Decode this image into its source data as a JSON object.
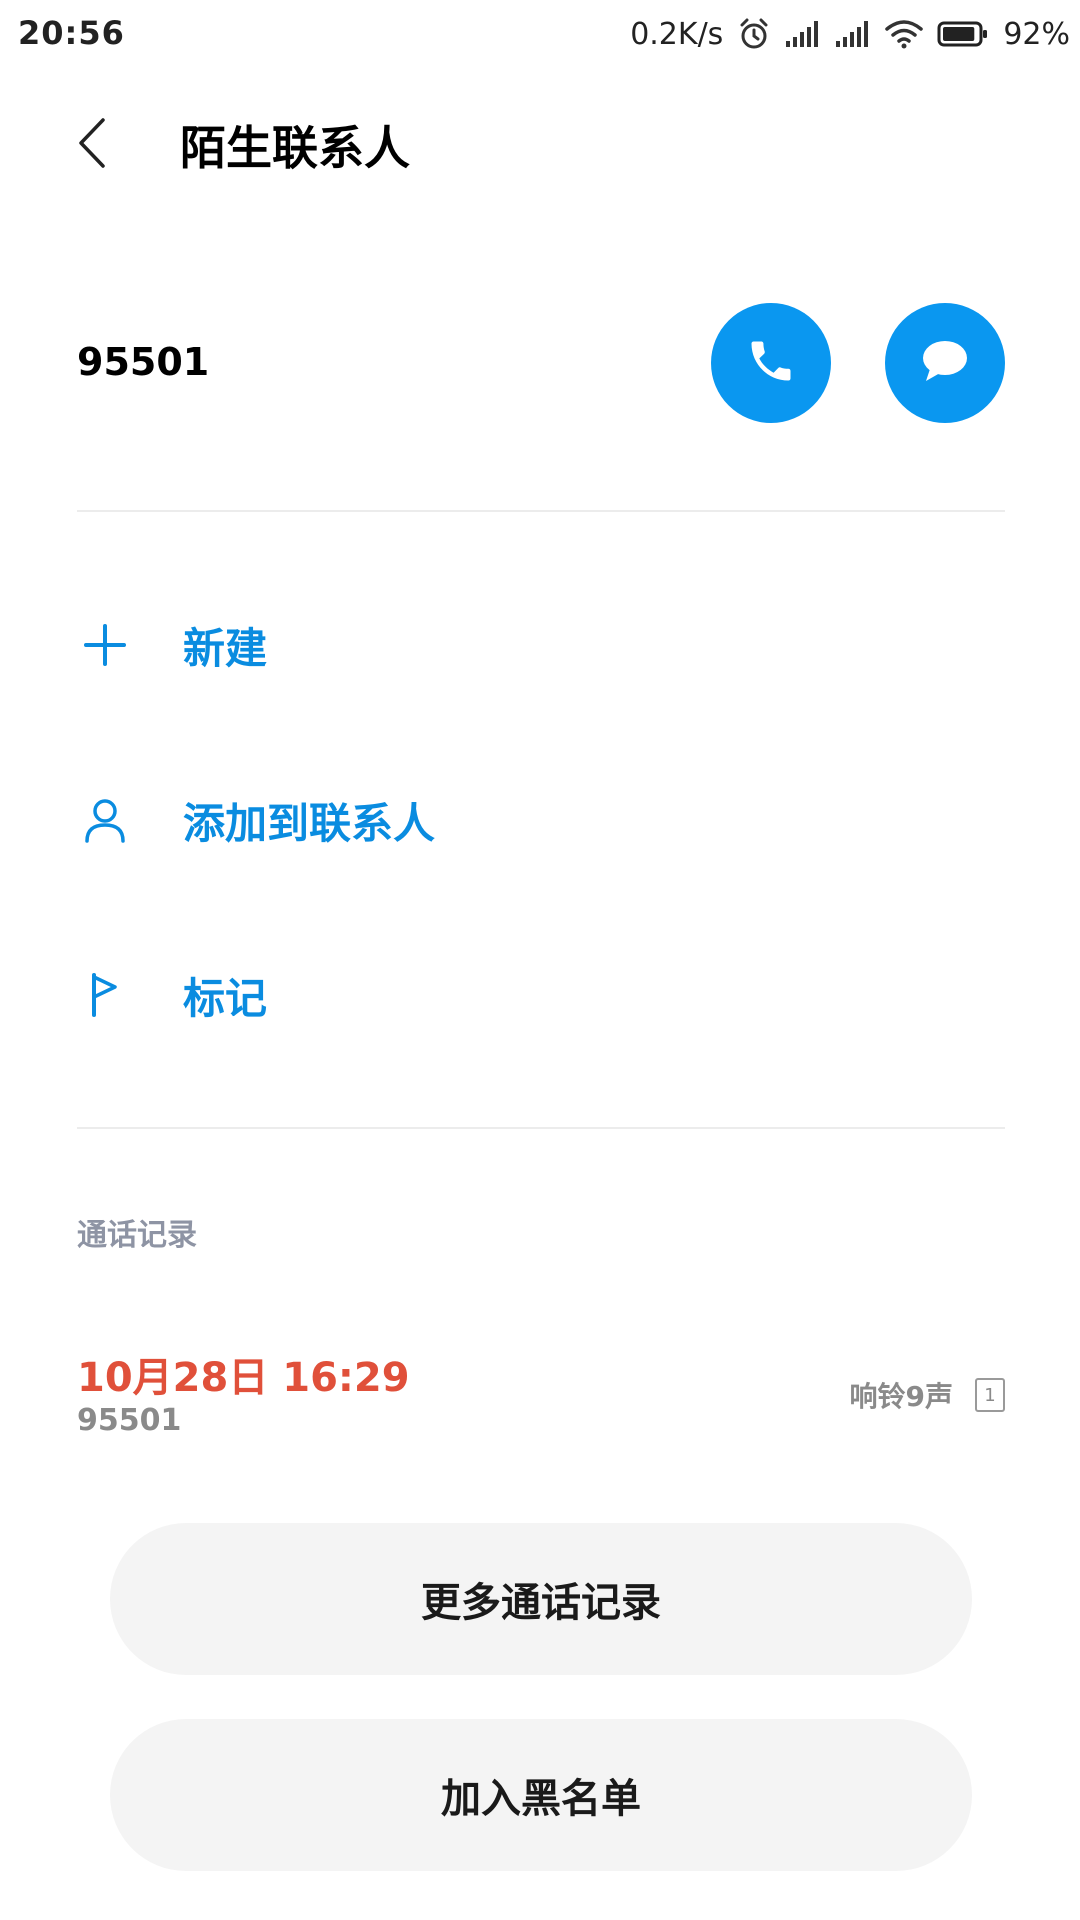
{
  "status_bar": {
    "time": "20:56",
    "net_speed": "0.2K/s",
    "battery_percent": "92%",
    "battery_level": 0.92,
    "icons": [
      "alarm-icon",
      "cell-signal-icon",
      "cell-signal-icon",
      "wifi-icon",
      "battery-icon"
    ]
  },
  "header": {
    "title": "陌生联系人",
    "back_icon": "chevron-left-icon"
  },
  "contact": {
    "number": "95501",
    "call_icon": "phone-icon",
    "message_icon": "message-bubble-icon"
  },
  "actions": [
    {
      "label": "新建",
      "icon": "plus-icon"
    },
    {
      "label": "添加到联系人",
      "icon": "person-icon"
    },
    {
      "label": "标记",
      "icon": "flag-icon"
    }
  ],
  "call_log": {
    "title": "通话记录",
    "entries": [
      {
        "datetime": "10月28日 16:29",
        "number": "95501",
        "detail": "响铃9声",
        "sim": "1"
      }
    ]
  },
  "buttons": {
    "more_calls": "更多通话记录",
    "blacklist": "加入黑名单"
  },
  "colors": {
    "accent": "#0a97f0",
    "action_text": "#0a8ce0",
    "missed_call": "#e0503a",
    "section_title": "#8e94a4",
    "pill_bg": "#f4f4f4"
  }
}
